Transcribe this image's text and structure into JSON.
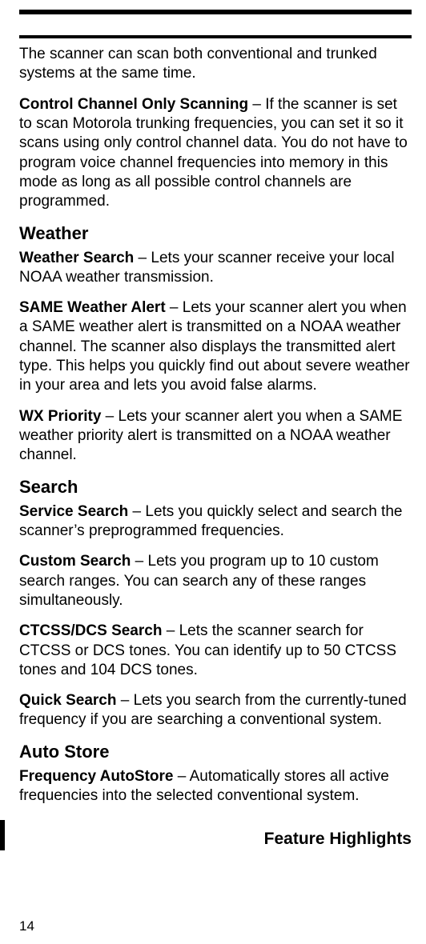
{
  "intro_para": "The scanner can scan both conventional and trunked systems at the same time.",
  "control_channel": {
    "term": "Control Channel Only Scanning",
    "text": " – If the scanner is set to scan Motorola trunking frequencies, you can set it so it scans using only control channel data. You do not have to program voice channel frequencies into memory in this mode as long as all possible control channels are programmed."
  },
  "weather_heading": "Weather",
  "weather_search": {
    "term": "Weather Search",
    "text": " – Lets your scanner receive your local NOAA weather transmission."
  },
  "same_alert": {
    "term": "SAME Weather Alert",
    "text": " – Lets your scanner alert you when a SAME weather alert is transmitted on a NOAA weather channel. The scanner also displays the transmitted alert type. This helps you quickly find out about severe weather in your area and lets you avoid false alarms."
  },
  "wx_priority": {
    "term": "WX Priority",
    "text": " – Lets your scanner alert you when a SAME weather priority alert is transmitted on a NOAA weather channel."
  },
  "search_heading": "Search",
  "service_search": {
    "term": "Service Search",
    "text": " – Lets you quickly select and search the scanner’s preprogrammed frequencies."
  },
  "custom_search": {
    "term": "Custom Search",
    "text": " – Lets you program up to 10 custom search ranges. You can search any of these ranges simultaneously."
  },
  "ctcss_search": {
    "term": "CTCSS/DCS Search",
    "text": " – Lets the scanner search for CTCSS or DCS tones. You can identify up to 50 CTCSS tones and 104 DCS tones."
  },
  "quick_search": {
    "term": "Quick Search",
    "text": " – Lets you search from the currently-tuned frequency if you are searching a conventional system."
  },
  "autostore_heading": "Auto Store",
  "freq_autostore": {
    "term": "Frequency AutoStore",
    "text": " – Automatically stores all active frequencies into the selected conventional system."
  },
  "footer_title": "Feature Highlights",
  "page_number": "14"
}
